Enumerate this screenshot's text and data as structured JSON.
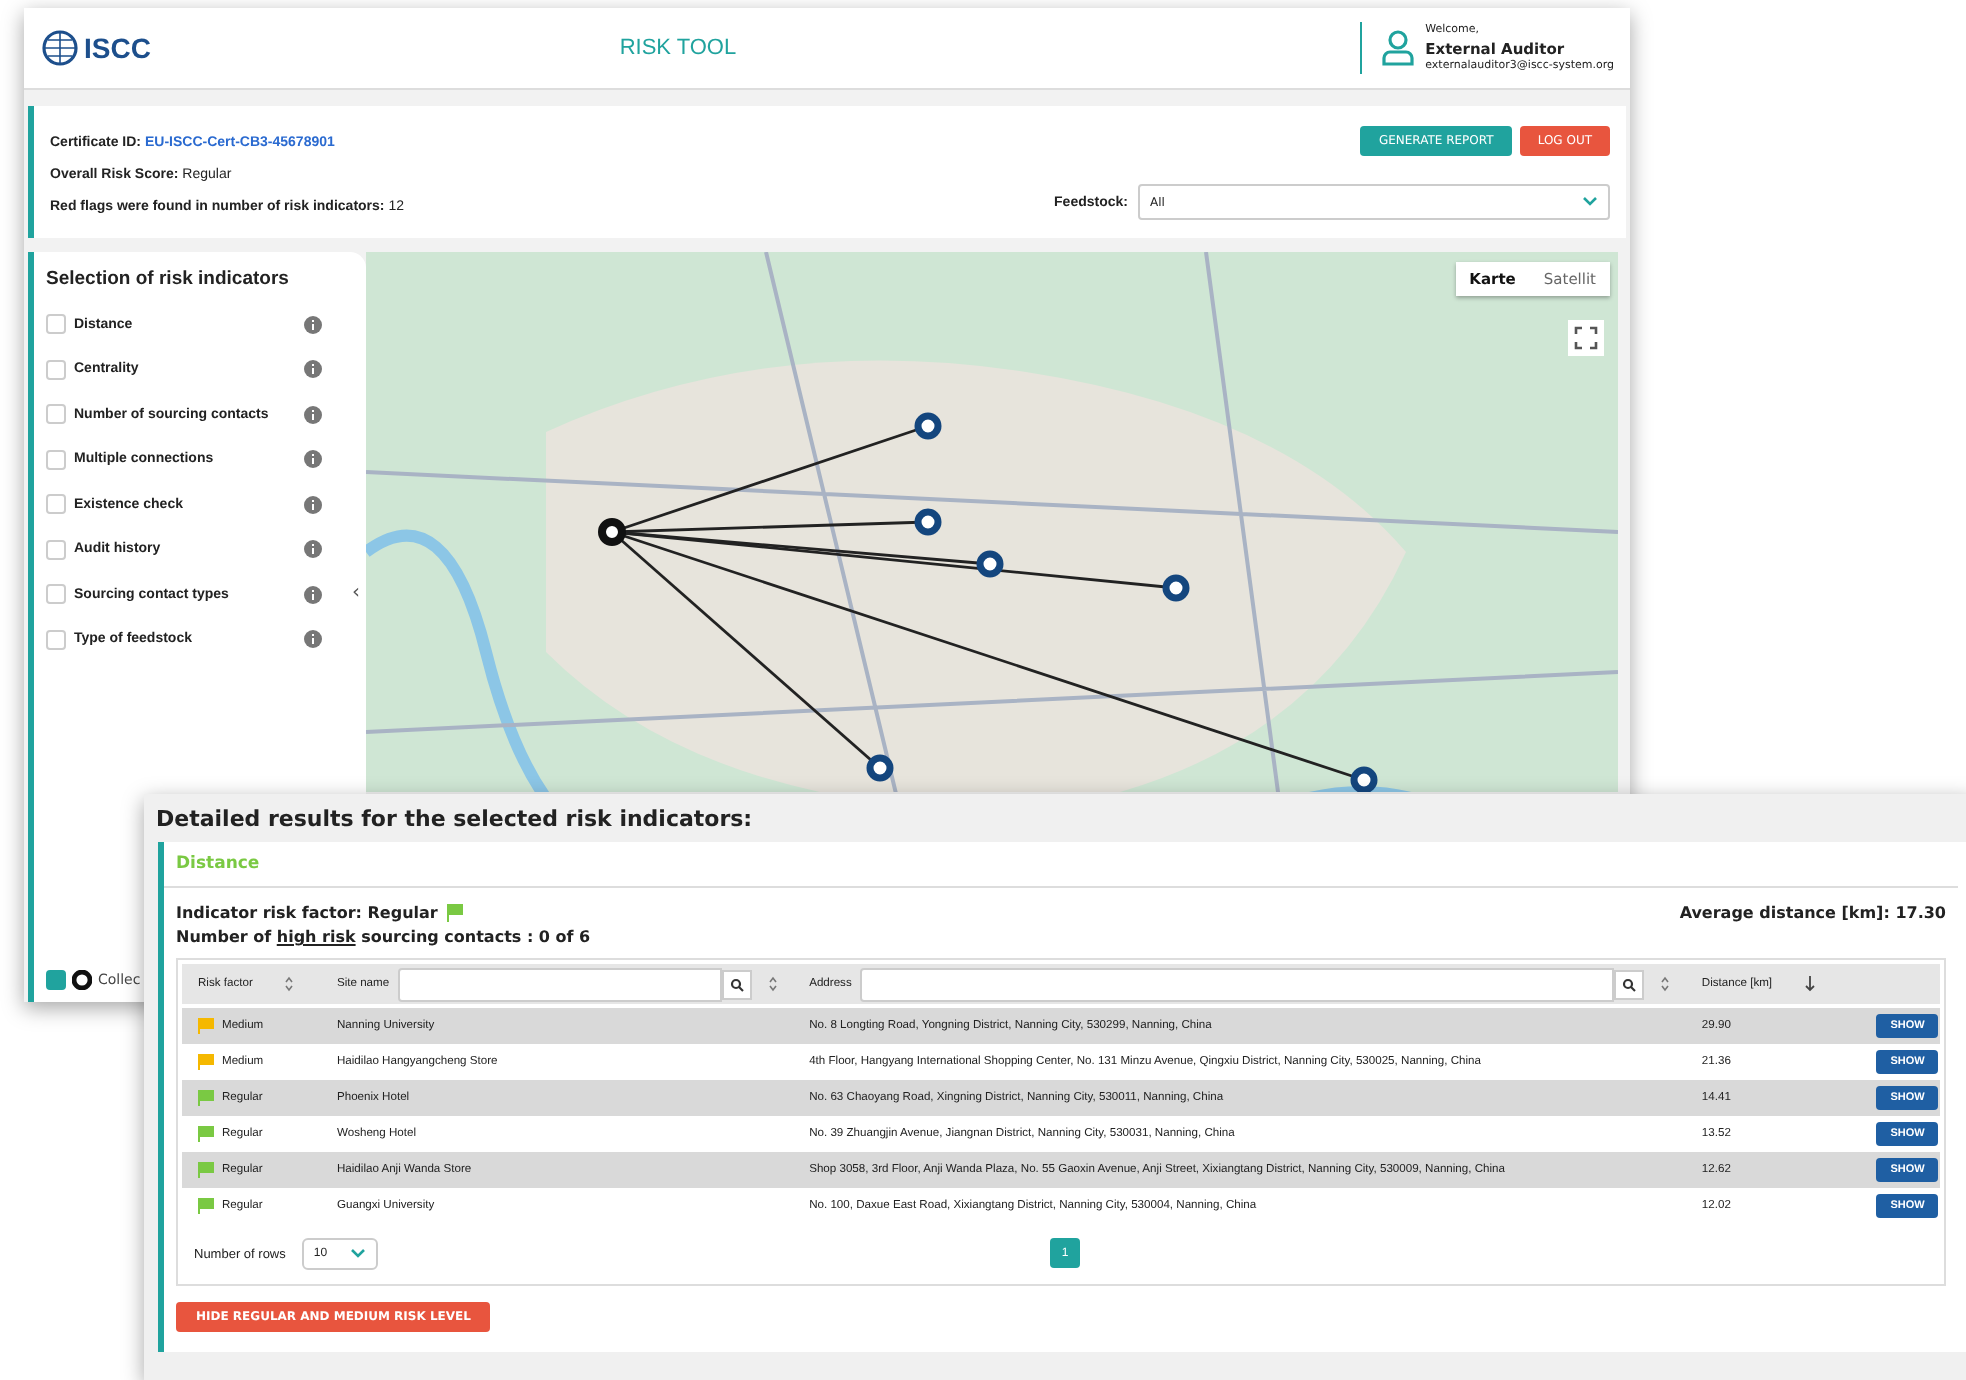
{
  "header": {
    "logo_text": "ISCC",
    "title": "RISK TOOL",
    "welcome": "Welcome,",
    "user_name": "External Auditor",
    "user_email": "externalauditor3@iscc-system.org"
  },
  "summary": {
    "certificate_label": "Certificate ID:",
    "certificate_id": "EU-ISCC-Cert-CB3-45678901",
    "score_label": "Overall Risk Score:",
    "score_value": "Regular",
    "flags_label": "Red flags were found in number of risk indicators:",
    "flags_value": "12",
    "feedstock_label": "Feedstock:",
    "feedstock_value": "All",
    "buttons": [
      {
        "label": "GENERATE REPORT",
        "kind": "primary"
      },
      {
        "label": "LOG OUT",
        "kind": "danger"
      }
    ]
  },
  "indicators": {
    "title": "Selection of risk indicators",
    "items": [
      {
        "label": "Distance",
        "checked": false
      },
      {
        "label": "Centrality",
        "checked": false
      },
      {
        "label": "Number of sourcing contacts",
        "checked": false
      },
      {
        "label": "Multiple connections",
        "checked": false
      },
      {
        "label": "Existence check",
        "checked": false
      },
      {
        "label": "Audit history",
        "checked": false
      },
      {
        "label": "Sourcing contact types",
        "checked": false
      },
      {
        "label": "Type of feedstock",
        "checked": false
      }
    ],
    "collapse": "‹",
    "legend": {
      "label": "Collec",
      "checked": true
    }
  },
  "map": {
    "views": [
      {
        "label": "Karte",
        "selected": true
      },
      {
        "label": "Satellit",
        "selected": false
      }
    ]
  },
  "results": {
    "title": "Detailed results for the selected risk indicators:",
    "section": "Distance",
    "risk_factor_label": "Indicator risk factor:",
    "risk_factor_value": "Regular",
    "risk_factor_flag": {
      "color": "#7ac943"
    },
    "high_risk_prefix": "Number of ",
    "high_risk_underlined": "high risk",
    "high_risk_suffix": " sourcing contacts : 0 of 6",
    "average": "Average distance [km]: 17.30",
    "columns": [
      {
        "label": "Risk factor",
        "kind": "sort"
      },
      {
        "label": "Site name",
        "kind": "search"
      },
      {
        "label": "Address",
        "kind": "search"
      },
      {
        "label": "Distance [km]",
        "kind": "sorted"
      }
    ],
    "rows": [
      {
        "risk": "Medium",
        "color": "#f5b800",
        "site": "Nanning University",
        "address": "No. 8 Longting Road, Yongning District, Nanning City, 530299, Nanning, China",
        "distance": "29.90",
        "action": "SHOW"
      },
      {
        "risk": "Medium",
        "color": "#f5b800",
        "site": "Haidilao Hangyangcheng Store",
        "address": "4th Floor, Hangyang International Shopping Center, No. 131 Minzu Avenue, Qingxiu District, Nanning City, 530025, Nanning, China",
        "distance": "21.36",
        "action": "SHOW"
      },
      {
        "risk": "Regular",
        "color": "#7ac943",
        "site": "Phoenix Hotel",
        "address": "No. 63 Chaoyang Road, Xingning District, Nanning City, 530011, Nanning, China",
        "distance": "14.41",
        "action": "SHOW"
      },
      {
        "risk": "Regular",
        "color": "#7ac943",
        "site": "Wosheng Hotel",
        "address": "No. 39 Zhuangjin Avenue, Jiangnan District, Nanning City, 530031, Nanning, China",
        "distance": "13.52",
        "action": "SHOW"
      },
      {
        "risk": "Regular",
        "color": "#7ac943",
        "site": "Haidilao Anji Wanda Store",
        "address": "Shop 3058, 3rd Floor, Anji Wanda Plaza, No. 55 Gaoxin Avenue, Anji Street, Xixiangtang District, Nanning City, 530009, Nanning, China",
        "distance": "12.62",
        "action": "SHOW"
      },
      {
        "risk": "Regular",
        "color": "#7ac943",
        "site": "Guangxi University",
        "address": "No. 100, Daxue East Road, Xixiangtang District, Nanning City, 530004, Nanning, China",
        "distance": "12.02",
        "action": "SHOW"
      }
    ],
    "rows_label": "Number of rows",
    "rows_value": "10",
    "pages": [
      {
        "label": "1",
        "selected": true
      }
    ],
    "hide_button": "HIDE REGULAR AND MEDIUM RISK LEVEL"
  }
}
